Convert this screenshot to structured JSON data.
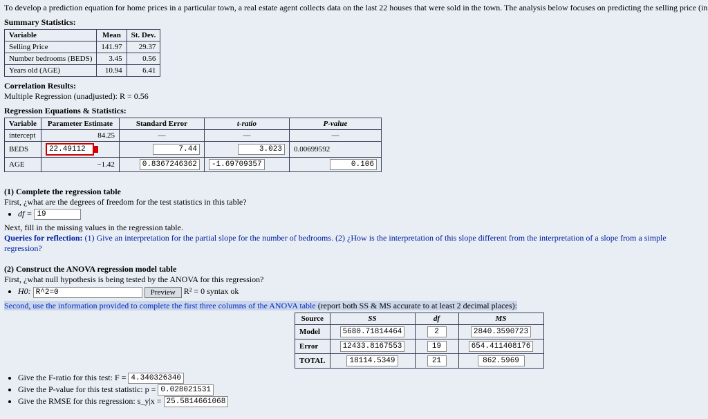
{
  "intro": "To develop a prediction equation for home prices in a particular town, a real estate agent collects data on the last 22 houses that were sold in the town.  The analysis below focuses on predicting the selling price (in thousands of dollars) from the number of bedrooms i",
  "summary": {
    "title": "Summary Statistics:",
    "cols": {
      "var": "Variable",
      "mean": "Mean",
      "sd": "St. Dev."
    },
    "rows": [
      {
        "var": "Selling Price",
        "mean": "141.97",
        "sd": "29.37"
      },
      {
        "var": "Number bedrooms (BEDS)",
        "mean": "3.45",
        "sd": "0.56"
      },
      {
        "var": "Years old (AGE)",
        "mean": "10.94",
        "sd": "6.41"
      }
    ]
  },
  "corr": {
    "title": "Correlation Results:",
    "line": "Multiple Regression (unadjusted):  R = 0.56"
  },
  "regr": {
    "title": "Regression Equations & Statistics:",
    "cols": {
      "var": "Variable",
      "est": "Parameter Estimate",
      "se": "Standard Error",
      "t": "t-ratio",
      "p": "P-value"
    },
    "rows": {
      "intercept": {
        "var": "intercept",
        "est": "84.25",
        "se": "—",
        "t": "—",
        "p": "—"
      },
      "beds": {
        "var": "BEDS",
        "est": "22.49112",
        "se": "7.44",
        "t": "3.023",
        "p": "0.00699592"
      },
      "age": {
        "var": "AGE",
        "est": "−1.42",
        "se": "0.8367246362",
        "t": "-1.69709357",
        "p": "0.106"
      }
    }
  },
  "q1": {
    "title": "(1)  Complete the regression table",
    "line1": "First, ¿what are the degrees of freedom for the test statistics in this table?",
    "df_label": "df =",
    "df_value": "19",
    "line2": "Next, fill in the missing values in the regression table.",
    "queries_label": "Queries for reflection:",
    "queries_text": "(1)  Give an interpretation for the partial slope for the number of bedrooms.   (2)  ¿How is the interpretation of this slope different from the interpretation of a slope from a simple regression?"
  },
  "q2": {
    "title": "(2)  Construct the ANOVA regression model table",
    "line1": "First, ¿what null hypothesis is being tested by the ANOVA for this regression?",
    "h0_label": "H0:",
    "h0_value": "R^2=0",
    "preview_btn": "Preview",
    "preview_result": "R² = 0 syntax ok",
    "hl": "Second, use the information provided to complete the first three columns of the ANOVA table",
    "hl_tail": " (report both SS & MS accurate to at least 2 decimal places):"
  },
  "anova": {
    "cols": {
      "src": "Source",
      "ss": "SS",
      "df": "df",
      "ms": "MS"
    },
    "rows": {
      "model": {
        "src": "Model",
        "ss": "5680.71814464",
        "df": "2",
        "ms": "2840.3590723"
      },
      "error": {
        "src": "Error",
        "ss": "12433.8167553",
        "df": "19",
        "ms": "654.411408176"
      },
      "total": {
        "src": "TOTAL",
        "ss": "18114.5349",
        "df": "21",
        "ms": "862.5969"
      }
    }
  },
  "tail": {
    "f_label": "Give the F-ratio for this test:  F =",
    "f_value": "4.340326340",
    "p_label": "Give the P-value for this test statistic:  p =",
    "p_value": "0.028021531",
    "rmse_label": "Give the RMSE for this regression:  s_y|x =",
    "rmse_value": "25.5814661068"
  }
}
